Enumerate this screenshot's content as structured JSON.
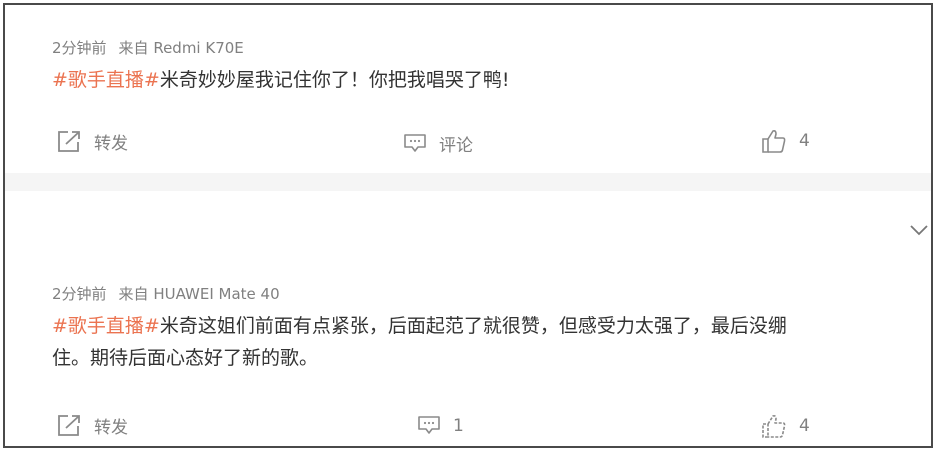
{
  "comments": [
    {
      "time": "2分钟前",
      "source": "来自 Redmi K70E",
      "hashtag": "#歌手直播#",
      "text": "米奇妙妙屋我记住你了！你把我唱哭了鸭!",
      "forward_label": "转发",
      "comment_label": "评论",
      "like_count": "4"
    },
    {
      "time": "2分钟前",
      "source": "来自 HUAWEI Mate 40",
      "hashtag": "#歌手直播#",
      "text_line1": "米奇这姐们前面有点紧张，后面起范了就很赞，但感受力太强了，最后没绷",
      "text_line2": "住。期待后面心态好了新的歌。",
      "forward_label": "转发",
      "comment_count": "1",
      "like_count": "4"
    }
  ],
  "colors": {
    "hashtag": "#eb7350",
    "meta": "#808080",
    "text": "#333333",
    "separator": "#f5f5f5"
  },
  "icons": [
    "forward-icon",
    "comment-icon",
    "like-icon",
    "chevron-down-icon"
  ]
}
